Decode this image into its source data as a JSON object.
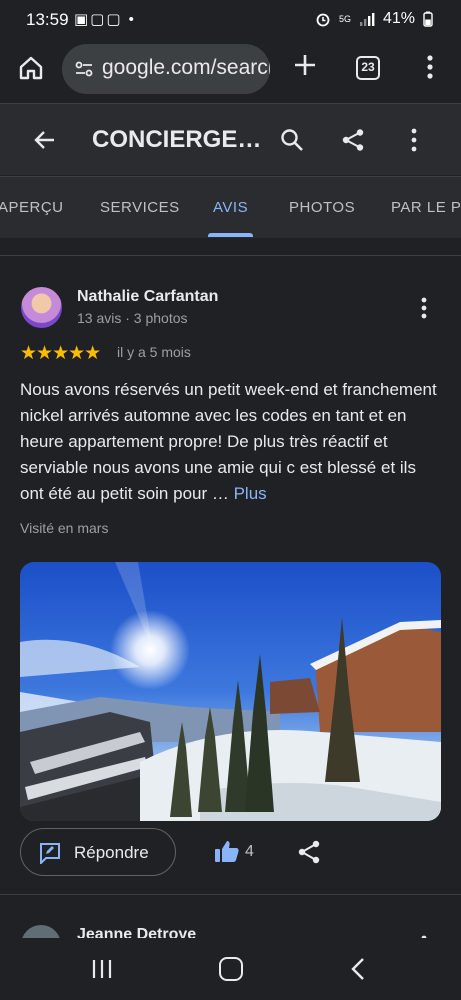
{
  "status": {
    "time": "13:59",
    "notification_icons": "▣▢▢ •",
    "network": "5G",
    "battery": "41%"
  },
  "browser": {
    "url": "google.com/search",
    "tab_count": "23"
  },
  "header": {
    "title": "CONCIERGE…"
  },
  "tabs": [
    {
      "label": "APERÇU",
      "active": false
    },
    {
      "label": "SERVICES",
      "active": false
    },
    {
      "label": "AVIS",
      "active": true
    },
    {
      "label": "PHOTOS",
      "active": false
    },
    {
      "label": "PAR LE PROPRIÉTAIRE",
      "active": false
    }
  ],
  "review": {
    "author": "Nathalie Carfantan",
    "meta": "13 avis · 3 photos",
    "stars": "★★★★★",
    "rating": 5,
    "time": "il y a 5 mois",
    "text": "Nous avons réservés un petit week-end et franchement nickel arrivés automne avec les codes en tant et en heure appartement propre! De plus très réactif et serviable nous avons une amie qui c est blessé et ils ont été au petit soin pour … ",
    "more": "Plus",
    "visited": "Visité en mars",
    "reply_label": "Répondre",
    "likes": "4"
  },
  "next_review": {
    "author": "Jeanne Detroye"
  },
  "colors": {
    "background": "#202124",
    "accent": "#8ab4f8",
    "star": "#fbbc04"
  }
}
